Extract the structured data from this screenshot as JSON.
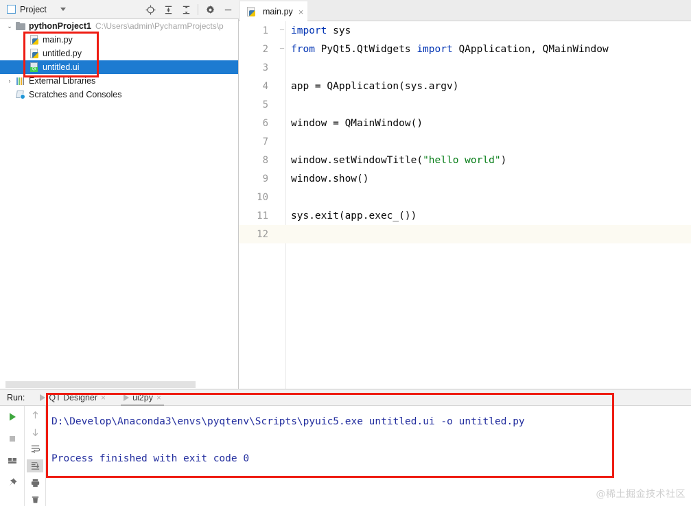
{
  "project_panel": {
    "title": "Project",
    "window_icon": "project-window-icon",
    "caret_icon": "chevron-down-icon",
    "toolbar": [
      {
        "name": "locate-target-icon",
        "glyph": "locate"
      },
      {
        "name": "expand-all-icon",
        "glyph": "expand"
      },
      {
        "name": "collapse-all-icon",
        "glyph": "collapse"
      },
      {
        "name": "settings-gear-icon",
        "glyph": "gear"
      },
      {
        "name": "hide-panel-icon",
        "glyph": "minus"
      }
    ],
    "tree": [
      {
        "label": "pythonProject1",
        "path": "C:\\Users\\admin\\PycharmProjects\\p",
        "icon": "folder-icon",
        "arrow": "⌄",
        "expanded": true,
        "bold": true,
        "indent": 0,
        "selected": false
      },
      {
        "label": "main.py",
        "icon": "python-file-icon",
        "arrow": "",
        "indent": 1,
        "selected": false
      },
      {
        "label": "untitled.py",
        "icon": "python-file-icon",
        "arrow": "",
        "indent": 1,
        "selected": false
      },
      {
        "label": "untitled.ui",
        "icon": "qt-ui-file-icon",
        "arrow": "",
        "indent": 1,
        "selected": true
      },
      {
        "label": "External Libraries",
        "icon": "external-libraries-icon",
        "arrow": "›",
        "indent": 0,
        "selected": false
      },
      {
        "label": "Scratches and Consoles",
        "icon": "scratches-icon",
        "arrow": "",
        "indent": 0,
        "selected": false
      }
    ]
  },
  "editor": {
    "tab": {
      "label": "main.py",
      "icon": "python-file-icon",
      "close": "×"
    },
    "lines": [
      {
        "num": "1",
        "fold": "─",
        "current": false,
        "tokens": [
          {
            "t": "import",
            "c": "kw"
          },
          {
            "t": " sys",
            "c": ""
          }
        ]
      },
      {
        "num": "2",
        "fold": "─",
        "current": false,
        "tokens": [
          {
            "t": "from",
            "c": "kw"
          },
          {
            "t": " PyQt5.QtWidgets ",
            "c": ""
          },
          {
            "t": "import",
            "c": "kw"
          },
          {
            "t": " QApplication, QMainWindow",
            "c": ""
          }
        ]
      },
      {
        "num": "3",
        "fold": "",
        "current": false,
        "tokens": []
      },
      {
        "num": "4",
        "fold": "",
        "current": false,
        "tokens": [
          {
            "t": "app = QApplication(sys.argv)",
            "c": ""
          }
        ]
      },
      {
        "num": "5",
        "fold": "",
        "current": false,
        "tokens": []
      },
      {
        "num": "6",
        "fold": "",
        "current": false,
        "tokens": [
          {
            "t": "window = QMainWindow()",
            "c": ""
          }
        ]
      },
      {
        "num": "7",
        "fold": "",
        "current": false,
        "tokens": []
      },
      {
        "num": "8",
        "fold": "",
        "current": false,
        "tokens": [
          {
            "t": "window.setWindowTitle(",
            "c": ""
          },
          {
            "t": "\"hello world\"",
            "c": "str"
          },
          {
            "t": ")",
            "c": ""
          }
        ]
      },
      {
        "num": "9",
        "fold": "",
        "current": false,
        "tokens": [
          {
            "t": "window.show()",
            "c": ""
          }
        ]
      },
      {
        "num": "10",
        "fold": "",
        "current": false,
        "tokens": []
      },
      {
        "num": "11",
        "fold": "",
        "current": false,
        "tokens": [
          {
            "t": "sys.exit(app.exec_())",
            "c": ""
          }
        ]
      },
      {
        "num": "12",
        "fold": "",
        "current": true,
        "tokens": []
      }
    ]
  },
  "run_panel": {
    "label": "Run:",
    "tabs": [
      {
        "name": "QT Designer",
        "active": false,
        "close": "×"
      },
      {
        "name": "ui2py",
        "active": true,
        "close": "×"
      }
    ],
    "toolbar_left": [
      {
        "name": "rerun-play-icon",
        "glyph": "play"
      },
      {
        "name": "stop-icon",
        "glyph": "stop"
      },
      {
        "name": "show-layout-icon",
        "glyph": "layout"
      },
      {
        "name": "pin-tab-icon",
        "glyph": "pin"
      }
    ],
    "toolbar_right": [
      {
        "name": "up-arrow-icon",
        "glyph": "up"
      },
      {
        "name": "down-arrow-icon",
        "glyph": "down"
      },
      {
        "name": "soft-wrap-icon",
        "glyph": "wrap"
      },
      {
        "name": "scroll-to-end-icon",
        "glyph": "scrollend",
        "highlighted": true
      },
      {
        "name": "print-icon",
        "glyph": "print"
      },
      {
        "name": "clear-all-icon",
        "glyph": "trash"
      }
    ],
    "console_lines": [
      "D:\\Develop\\Anaconda3\\envs\\pyqtenv\\Scripts\\pyuic5.exe untitled.ui -o untitled.py",
      "",
      "Process finished with exit code 0"
    ]
  },
  "annotations": {
    "color": "#ee1c12",
    "boxes": [
      {
        "name": "highlight-box-project-files"
      },
      {
        "name": "highlight-box-console-output"
      }
    ]
  },
  "watermark": {
    "text": "@稀土掘金技术社区"
  },
  "colors": {
    "selection_blue": "#1d7bd1",
    "keyword_blue": "#0033b3",
    "string_green": "#067d17",
    "console_text": "#222d9e",
    "annotation_red": "#ee1c12"
  }
}
